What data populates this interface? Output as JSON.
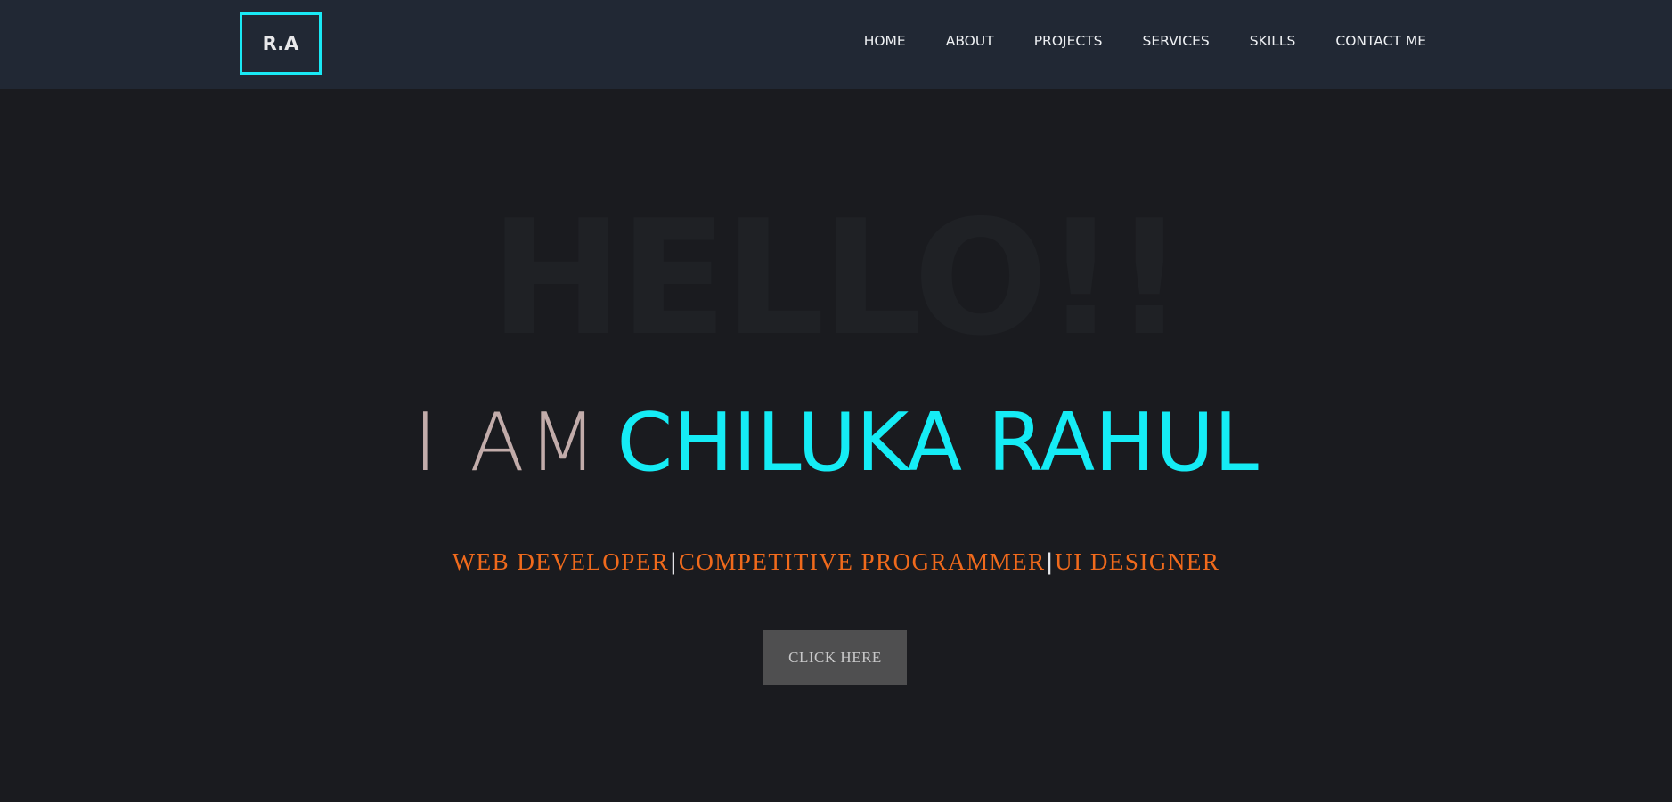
{
  "navbar": {
    "logo": "R.A",
    "links": [
      "HOME",
      "ABOUT",
      "PROJECTS",
      "SERVICES",
      "SKILLS",
      "CONTACT ME"
    ]
  },
  "hero": {
    "background_text": "HELLO!!",
    "prefix": "I AM",
    "name": "CHILUKA RAHUL",
    "roles": [
      "WEB DEVELOPER",
      "COMPETITIVE PROGRAMMER",
      "UI DESIGNER"
    ],
    "separator": "|",
    "button_label": "CLICK HERE"
  },
  "colors": {
    "background": "#1a1b1f",
    "navbar": "#212834",
    "accent": "#15ecf5",
    "roles": "#f06a1c",
    "button": "#4f4f50"
  }
}
